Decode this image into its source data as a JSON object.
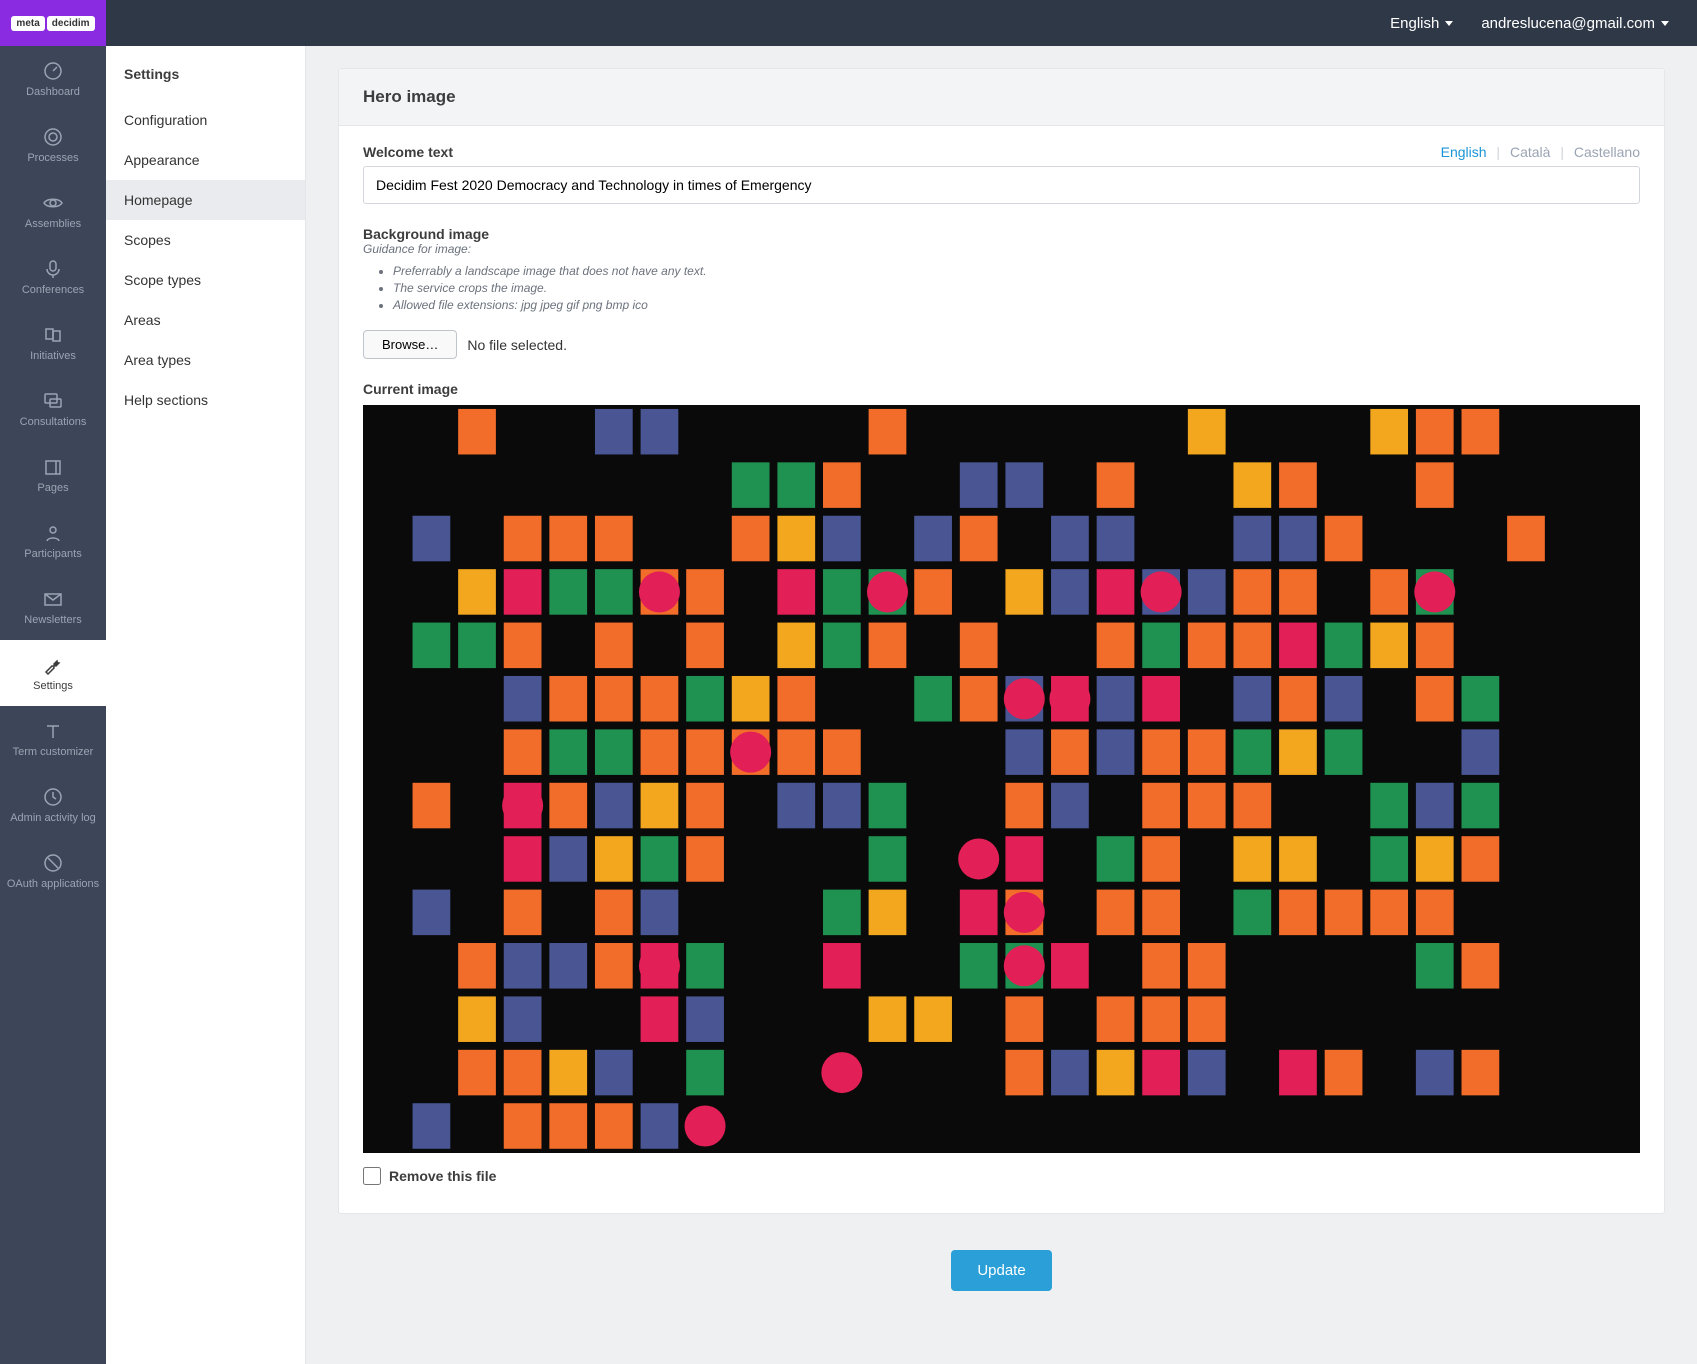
{
  "topbar": {
    "logo_a": "meta",
    "logo_b": "decidim",
    "language": "English",
    "user": "andreslucena@gmail.com"
  },
  "leftnav": [
    {
      "id": "dashboard",
      "label": "Dashboard",
      "icon": "dashboard"
    },
    {
      "id": "processes",
      "label": "Processes",
      "icon": "target"
    },
    {
      "id": "assemblies",
      "label": "Assemblies",
      "icon": "eye"
    },
    {
      "id": "conferences",
      "label": "Conferences",
      "icon": "mic"
    },
    {
      "id": "initiatives",
      "label": "Initiatives",
      "icon": "flag"
    },
    {
      "id": "consultations",
      "label": "Consultations",
      "icon": "chat"
    },
    {
      "id": "pages",
      "label": "Pages",
      "icon": "book"
    },
    {
      "id": "participants",
      "label": "Participants",
      "icon": "user"
    },
    {
      "id": "newsletters",
      "label": "Newsletters",
      "icon": "mail"
    },
    {
      "id": "settings",
      "label": "Settings",
      "icon": "wrench",
      "active": true
    },
    {
      "id": "term-customizer",
      "label": "Term customizer",
      "icon": "text"
    },
    {
      "id": "admin-activity-log",
      "label": "Admin activity log",
      "icon": "clock"
    },
    {
      "id": "oauth-applications",
      "label": "OAuth applications",
      "icon": "ban"
    }
  ],
  "secondnav": {
    "title": "Settings",
    "items": [
      {
        "id": "configuration",
        "label": "Configuration"
      },
      {
        "id": "appearance",
        "label": "Appearance"
      },
      {
        "id": "homepage",
        "label": "Homepage",
        "active": true
      },
      {
        "id": "scopes",
        "label": "Scopes"
      },
      {
        "id": "scope-types",
        "label": "Scope types"
      },
      {
        "id": "areas",
        "label": "Areas"
      },
      {
        "id": "area-types",
        "label": "Area types"
      },
      {
        "id": "help-sections",
        "label": "Help sections"
      }
    ]
  },
  "form": {
    "card_title": "Hero image",
    "welcome_label": "Welcome text",
    "lang_tabs": {
      "english": "English",
      "catala": "Català",
      "castellano": "Castellano"
    },
    "welcome_value": "Decidim Fest 2020 Democracy and Technology in times of Emergency",
    "bg_label": "Background image",
    "guidance_title": "Guidance for image:",
    "guidance_items": [
      "Preferrably a landscape image that does not have any text.",
      "The service crops the image.",
      "Allowed file extensions: jpg jpeg gif png bmp ico"
    ],
    "browse": "Browse…",
    "no_file": "No file selected.",
    "current_label": "Current image",
    "remove_label": "Remove this file",
    "update": "Update"
  },
  "hero_pattern": {
    "cols": 28,
    "rows": 14,
    "palette": {
      "k": "#0a0a0a",
      "o": "#f26c2a",
      "b": "#4a5694",
      "g": "#1f9251",
      "y": "#f3a71e",
      "p": "#e21f56"
    },
    "grid": [
      "kkokkbbkkkkokkkkkkykkkyook",
      "kkkkkkkkggokkbbkokkyokkokkk",
      "kbkoookkoybkbokbbkkbbokkko",
      "kkypggookpggokybpbbookogkk",
      "kggokokokygokokkogoopgyokk",
      "kkkbooogyokkgobpbpkbobkogk",
      "kkkoggoooookkkboboogygkkbk",
      "kokpobyokbbgkkobkoookkgbgk",
      "kkkpbygokkkgkkpkgokyykgyok",
      "kbkokobkkkgykposookgooookk",
      "kkobbopgkkpkkggpkookkkkgok",
      "kkybkkpbkkkyykokoookkkkkkkk",
      "kkooybkgkkkkkkobypbkpokbok",
      "kbkooobkkkkkkkkkkkkkkkkkkkk"
    ],
    "circles": [
      [
        3,
        6
      ],
      [
        3,
        11
      ],
      [
        3,
        17
      ],
      [
        3,
        23
      ],
      [
        5,
        14
      ],
      [
        5,
        15
      ],
      [
        6,
        8
      ],
      [
        7,
        3
      ],
      [
        8,
        13
      ],
      [
        9,
        14
      ],
      [
        10,
        6
      ],
      [
        10,
        14
      ],
      [
        12,
        10
      ],
      [
        13,
        7
      ]
    ]
  }
}
